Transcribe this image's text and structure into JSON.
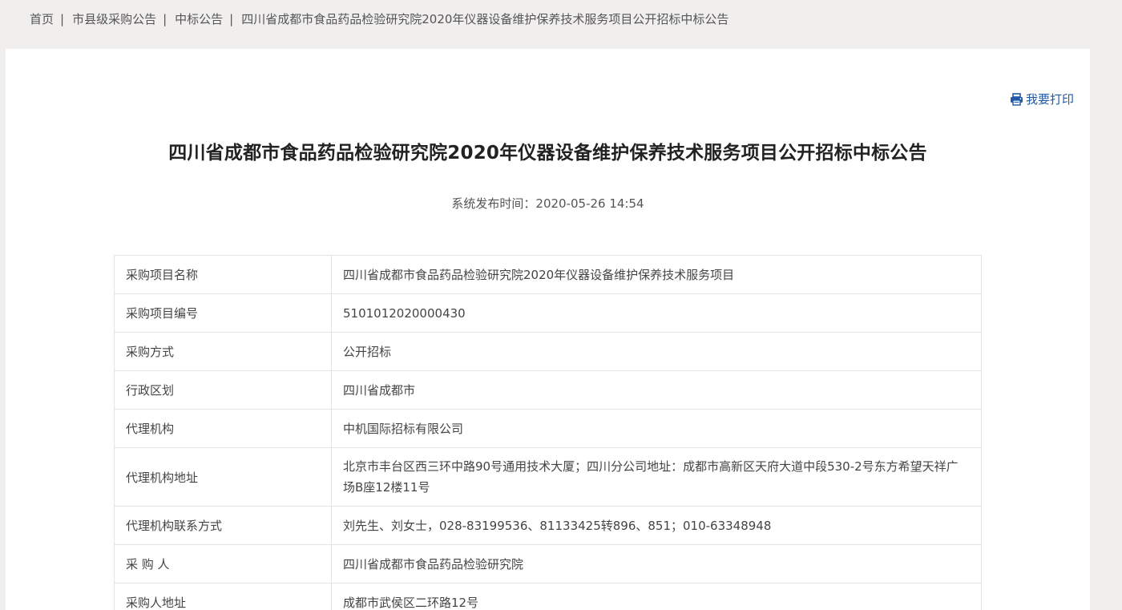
{
  "breadcrumb": {
    "items": [
      "首页",
      "市县级采购公告",
      "中标公告",
      "四川省成都市食品药品检验研究院2020年仪器设备维护保养技术服务项目公开招标中标公告"
    ],
    "separator": "|"
  },
  "print": {
    "label": "我要打印",
    "icon": "printer-icon"
  },
  "article": {
    "title": "四川省成都市食品药品检验研究院2020年仪器设备维护保养技术服务项目公开招标中标公告",
    "publish_time": "系统发布时间：2020-05-26 14:54"
  },
  "info_table": {
    "rows": [
      {
        "label": "采购项目名称",
        "value": "四川省成都市食品药品检验研究院2020年仪器设备维护保养技术服务项目"
      },
      {
        "label": "采购项目编号",
        "value": "5101012020000430"
      },
      {
        "label": "采购方式",
        "value": "公开招标"
      },
      {
        "label": "行政区划",
        "value": "四川省成都市"
      },
      {
        "label": "代理机构",
        "value": "中机国际招标有限公司"
      },
      {
        "label": "代理机构地址",
        "value": "北京市丰台区西三环中路90号通用技术大厦；四川分公司地址：成都市高新区天府大道中段530-2号东方希望天祥广场B座12楼11号"
      },
      {
        "label": "代理机构联系方式",
        "value": "刘先生、刘女士，028-83199536、81133425转896、851；010-63348948"
      },
      {
        "label": "采 购 人",
        "value": "四川省成都市食品药品检验研究院"
      },
      {
        "label": "采购人地址",
        "value": "成都市武侯区二环路12号"
      }
    ]
  },
  "colors": {
    "page_bg": "#f1eeee",
    "panel_bg": "#ffffff",
    "link_blue": "#1e5aa8",
    "border": "#e3e3e3"
  }
}
